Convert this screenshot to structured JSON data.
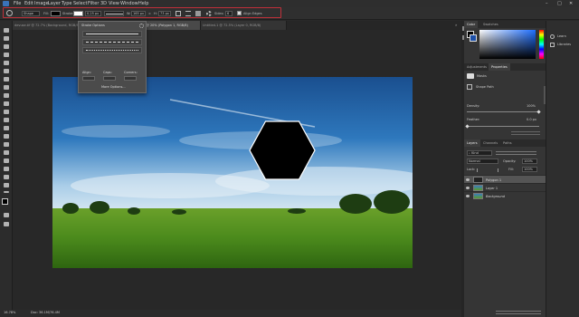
{
  "menu": [
    "File",
    "Edit",
    "Image",
    "Layer",
    "Type",
    "Select",
    "Filter",
    "3D",
    "View",
    "Window",
    "Help"
  ],
  "options": {
    "mode": "Shape",
    "fill_label": "Fill:",
    "stroke_label": "Stroke:",
    "stroke_width": "0.25 px",
    "w_label": "W:",
    "w_value": "165 px",
    "h_label": "H:",
    "h_value": "73 px",
    "sides_label": "Sides:",
    "sides_value": "6",
    "align_edges": "Align Edges"
  },
  "tabs": [
    "devuse.tif @ 72.7% (Background, RGB/8)",
    "Untitled-1 @ 72.7% (Layer 1, RGB/8)",
    "1 @ 20% (Polygon 1, RGB/8)",
    "Untitled-1 @ 72.5% (Layer 0, RGB/8)"
  ],
  "stroke_options": {
    "title": "Stroke Options",
    "align_label": "Align:",
    "caps_label": "Caps:",
    "corners_label": "Corners:",
    "more": "More Options..."
  },
  "status": {
    "zoom": "16.78%",
    "doc": "Doc: 36.1M/76.4M"
  },
  "color_panel": {
    "tabs": [
      "Color",
      "Swatches"
    ]
  },
  "props_panel": {
    "tabs": [
      "Adjustments",
      "Properties"
    ],
    "section": "Masks",
    "row": "Shape Path",
    "density_label": "Density:",
    "density_value": "100%",
    "feather_label": "Feather:",
    "feather_value": "0.0 px"
  },
  "layers_panel": {
    "tabs": [
      "Layers",
      "Channels",
      "Paths"
    ],
    "kind": "Kind",
    "blend": "Normal",
    "opacity_label": "Opacity:",
    "opacity_value": "100%",
    "lock_label": "Lock:",
    "fill_label": "Fill:",
    "fill_value": "100%",
    "layers": [
      "Polygon 1",
      "Layer 1",
      "Background"
    ]
  },
  "right_strip": {
    "items": [
      "Learn",
      "Libraries"
    ]
  }
}
